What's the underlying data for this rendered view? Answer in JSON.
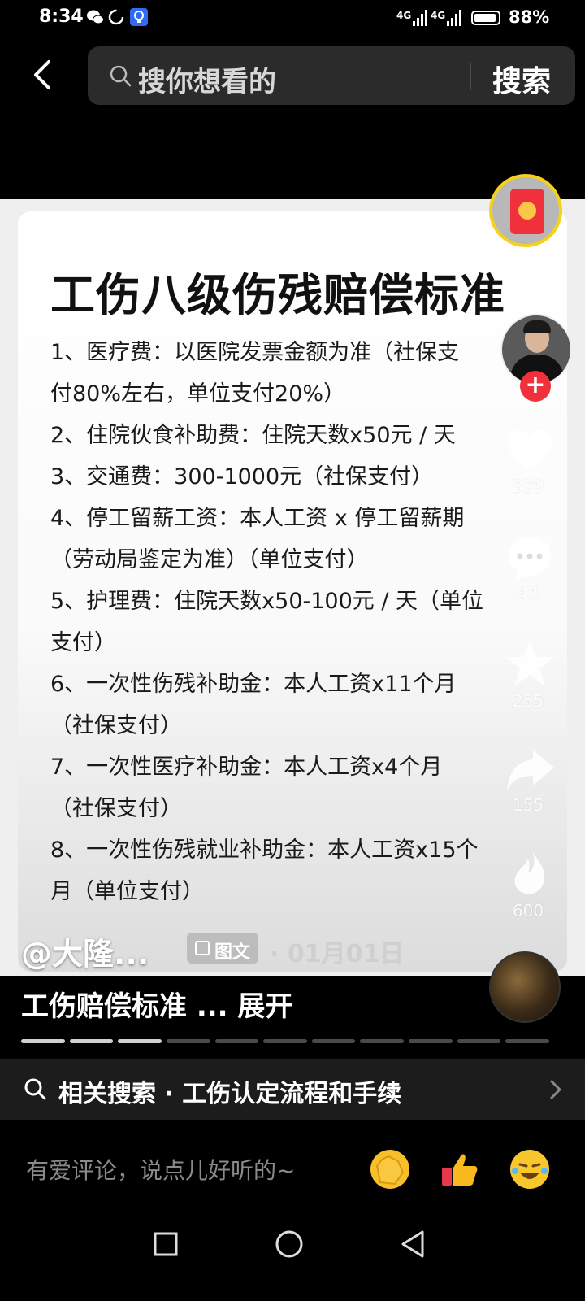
{
  "status_bar": {
    "time": "8:34",
    "network_1": "4G",
    "network_2": "4G",
    "battery": "88%"
  },
  "top_bar": {
    "search_placeholder": "搜你想看的",
    "search_button": "搜索"
  },
  "post": {
    "title": "工伤八级伤残赔偿标准",
    "lines": [
      "1、医疗费：以医院发票金额为准（社保支",
      "付80%左右，单位支付20%）",
      "2、住院伙食补助费：住院天数x50元 / 天",
      "3、交通费：300-1000元（社保支付）",
      "4、停工留薪工资：本人工资 x 停工留薪期",
      "（劳动局鉴定为准）（单位支付）",
      "5、护理费：住院天数x50-100元 / 天（单位",
      "支付）",
      "6、一次性伤残补助金：本人工资x11个月",
      "（社保支付）",
      "7、一次性医疗补助金：本人工资x4个月",
      "（社保支付）",
      "8、一次性伤残就业补助金：本人工资x15个",
      "月（单位支付）"
    ]
  },
  "rail": {
    "like_count": "329",
    "comment_count": "43",
    "favorite_count": "255",
    "share_count": "155",
    "recommend_count": "600"
  },
  "info": {
    "author": "@大隆...",
    "type_tag": "图文",
    "date": "· 01月01日",
    "caption": "工伤赔偿标准 ... 展开"
  },
  "progress": {
    "total_pages": 11,
    "current_page": 3
  },
  "related": {
    "text": "相关搜索 · 工伤认定流程和手续"
  },
  "comment_bar": {
    "placeholder": "有爱评论，说点儿好听的~"
  },
  "colors": {
    "accent_red": "#f0303a",
    "ring_yellow": "#f6d11c"
  }
}
